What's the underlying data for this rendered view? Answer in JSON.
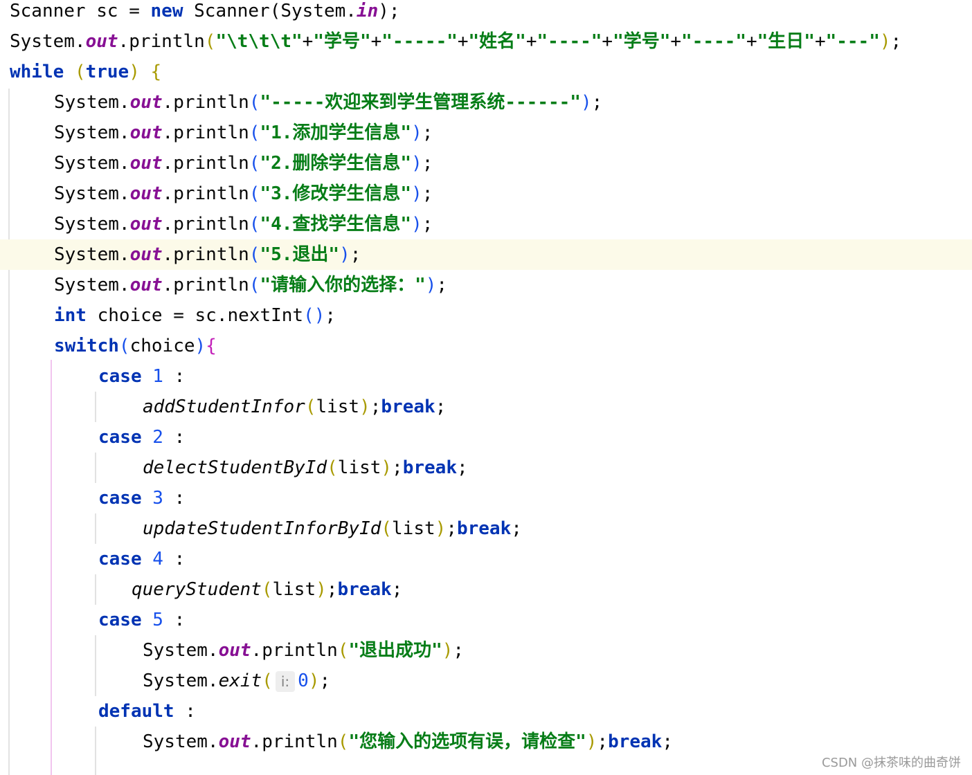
{
  "lines": [
    {
      "text": "Scanner sc = new Scanner(System.in);"
    },
    {
      "text": "System.out.println(\"\\t\\t\\t\"+\"学号\"+\"-----\"+\"姓名\"+\"----\"+\"学号\"+\"----\"+\"生日\"+\"---\");"
    },
    {
      "text": "while (true) {"
    },
    {
      "text": "System.out.println(\"-----欢迎来到学生管理系统------\");"
    },
    {
      "text": "System.out.println(\"1.添加学生信息\");"
    },
    {
      "text": "System.out.println(\"2.删除学生信息\");"
    },
    {
      "text": "System.out.println(\"3.修改学生信息\");"
    },
    {
      "text": "System.out.println(\"4.查找学生信息\");"
    },
    {
      "text": "System.out.println(\"5.退出\");"
    },
    {
      "text": "System.out.println(\"请输入你的选择：\");"
    },
    {
      "text": "int choice = sc.nextInt();"
    },
    {
      "text": "switch(choice){"
    },
    {
      "text": "case 1 :"
    },
    {
      "text": "addStudentInfor(list);break;"
    },
    {
      "text": "case 2 :"
    },
    {
      "text": "delectStudentById(list);break;"
    },
    {
      "text": "case 3 :"
    },
    {
      "text": "updateStudentInforById(list);break;"
    },
    {
      "text": "case 4 :"
    },
    {
      "text": "queryStudent(list);break;"
    },
    {
      "text": "case 5 :"
    },
    {
      "text": "System.out.println(\"退出成功\");"
    },
    {
      "text": "System.exit( i: 0);"
    },
    {
      "text": "default :"
    },
    {
      "text": "System.out.println(\"您输入的选项有误，请检查\");break;"
    }
  ],
  "tokens": {
    "Scanner": "Scanner",
    "sc": "sc",
    "eq": "=",
    "new": "new",
    "System": "System",
    "dot": ".",
    "in": "in",
    "out": "out",
    "println": "println",
    "lparen": "(",
    "rparen": ")",
    "semi": ";",
    "plus": "+",
    "lbrace": "{",
    "rbrace": "}",
    "colon": ":",
    "while": "while",
    "true": "true",
    "int": "int",
    "choice": "choice",
    "nextInt": "nextInt",
    "switch": "switch",
    "case": "case",
    "break": "break",
    "default": "default",
    "list": "list",
    "exit": "exit",
    "hint_i": "i:",
    "n0": "0",
    "n1": "1",
    "n2": "2",
    "n3": "3",
    "n4": "4",
    "n5": "5",
    "m_add": "addStudentInfor",
    "m_delect": "delectStudentById",
    "m_update": "updateStudentInforById",
    "m_query": "queryStudent",
    "s_tabs": "\"\\t\\t\\t\"",
    "s_xuehao": "\"学号\"",
    "s_d5": "\"-----\"",
    "s_xingming": "\"姓名\"",
    "s_d4": "\"----\"",
    "s_shengri": "\"生日\"",
    "s_d3": "\"---\"",
    "s_welcome": "\"-----欢迎来到学生管理系统------\"",
    "s_opt1": "\"1.添加学生信息\"",
    "s_opt2": "\"2.删除学生信息\"",
    "s_opt3": "\"3.修改学生信息\"",
    "s_opt4": "\"4.查找学生信息\"",
    "s_opt5": "\"5.退出\"",
    "s_prompt": "\"请输入你的选择：\"",
    "s_exit_ok": "\"退出成功\"",
    "s_err": "\"您输入的选项有误，请检查\""
  },
  "watermark": "CSDN @抹茶味的曲奇饼",
  "colors": {
    "keyword": "#0033b3",
    "static_field": "#871094",
    "string": "#067d17",
    "number": "#1750eb",
    "current_line": "#fcfae9"
  }
}
